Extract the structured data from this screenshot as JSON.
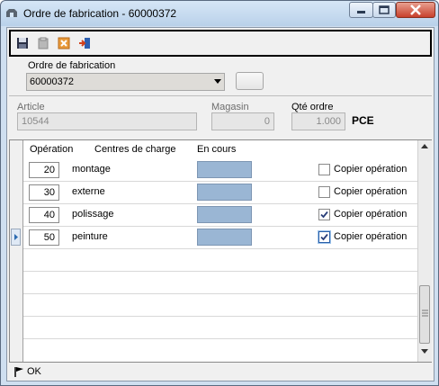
{
  "window": {
    "title": "Ordre de fabrication - 60000372"
  },
  "toolbar": {
    "icons": [
      "save-icon",
      "document-icon",
      "cancel-icon",
      "exit-icon"
    ]
  },
  "form": {
    "ordre_label": "Ordre de fabrication",
    "ordre_value": "60000372",
    "article_label": "Article",
    "article_value": "10544",
    "magasin_label": "Magasin",
    "magasin_value": "0",
    "qte_label": "Qté ordre",
    "qte_value": "1.000",
    "unit": "PCE"
  },
  "grid": {
    "headers": {
      "operation": "Opération",
      "centres": "Centres de charge",
      "en_cours": "En cours"
    },
    "rows": [
      {
        "op": "20",
        "centre": "montage",
        "checked": false,
        "copy_label": "Copier opération"
      },
      {
        "op": "30",
        "centre": "externe",
        "checked": false,
        "copy_label": "Copier opération"
      },
      {
        "op": "40",
        "centre": "polissage",
        "checked": true,
        "copy_label": "Copier opération"
      },
      {
        "op": "50",
        "centre": "peinture",
        "checked": true,
        "copy_label": "Copier opération"
      }
    ],
    "bar_color": "#9ab6d4"
  },
  "status": {
    "text": "OK"
  }
}
